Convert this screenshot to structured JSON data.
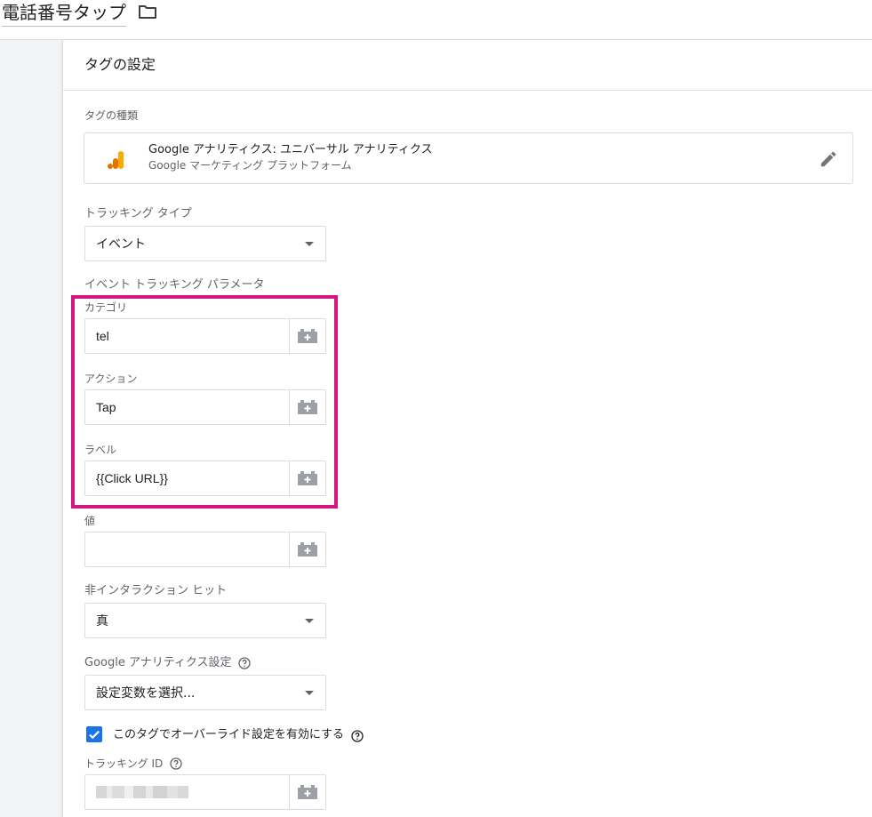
{
  "header": {
    "tag_name": "電話番号タップ"
  },
  "card": {
    "title": "タグの設定",
    "tag_type_label": "タグの種類",
    "tag_type": {
      "title": "Google アナリティクス: ユニバーサル アナリティクス",
      "subtitle": "Google マーケティング プラットフォーム"
    },
    "tracking_type_label": "トラッキング タイプ",
    "tracking_type_value": "イベント",
    "event_params_label": "イベント トラッキング パラメータ",
    "category": {
      "label": "カテゴリ",
      "value": "tel"
    },
    "action": {
      "label": "アクション",
      "value": "Tap"
    },
    "event_label": {
      "label": "ラベル",
      "value": "{{Click URL}}"
    },
    "event_value": {
      "label": "値",
      "value": ""
    },
    "non_interaction": {
      "label": "非インタラクション ヒット",
      "value": "真"
    },
    "ga_settings": {
      "label": "Google アナリティクス設定",
      "value": "設定変数を選択..."
    },
    "override": {
      "label": "このタグでオーバーライド設定を有効にする",
      "checked": true
    },
    "tracking_id": {
      "label": "トラッキング ID"
    }
  },
  "colors": {
    "highlight": "#d4147f",
    "checkbox": "#1a73e8",
    "ga_orange": "#f9ab00",
    "ga_dark_orange": "#e37400"
  }
}
